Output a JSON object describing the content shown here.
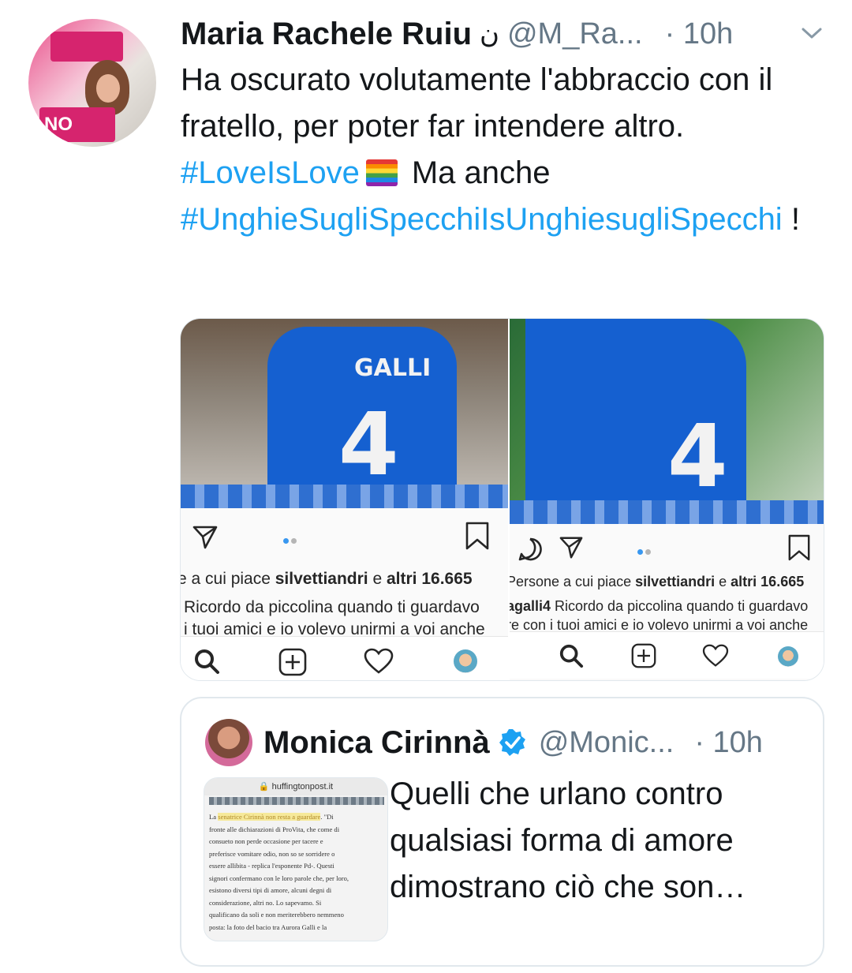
{
  "tweet": {
    "author": {
      "name": "Maria Rachele Ruiu",
      "name_extra": "ن",
      "handle": "@M_Ra...",
      "time": "· 10h",
      "avatar_badge_text": "NO"
    },
    "text": {
      "part1": "Ha oscurato volutamente l'abbraccio con il fratello, per poter far intendere altro. ",
      "hashtag1": "#LoveIsLove",
      "part2": "Ma anche",
      "hashtag2": "#UnghieSugliSpecchiIsUnghiesugliSpecchi",
      "part3": " !"
    },
    "media": {
      "left": {
        "jersey_name": "GALLI",
        "jersey_number": "4",
        "likes_prefix": "e a cui piace ",
        "likes_user": "silvettiandri",
        "likes_middle": " e ",
        "likes_others": "altri 16.665",
        "caption_line1": "Ricordo da piccolina quando ti guardavo",
        "caption_line2": "i tuoi amici e io volevo unirmi a voi anche"
      },
      "right": {
        "jersey_number": "4",
        "likes_prefix": "Persone a cui piace ",
        "likes_user": "silvettiandri",
        "likes_middle": " e ",
        "likes_others": "altri 16.665",
        "caption_user": "agalli4",
        "caption_line1": " Ricordo da piccolina quando ti guardavo",
        "caption_line2": "re con i tuoi amici e io volevo unirmi a voi anche"
      }
    }
  },
  "quoted": {
    "author": {
      "name": "Monica Cirinnà",
      "handle": "@Monic...",
      "time": "· 10h"
    },
    "thumbnail": {
      "url": "huffingtonpost.it",
      "line1_pre": "La ",
      "line1_hl": "senatrice Cirinnà non resta a guardare",
      "line1_post": ". \"Di",
      "line2": "fronte alle dichiarazioni di ProVita, che come di",
      "line3": "consueto non perde occasione per tacere e",
      "line4": "preferisce vomitare odio, non so se sorridere o",
      "line5": "essere allibita - replica l'esponente Pd-. Questi",
      "line6": "signori confermano con le loro parole che, per loro,",
      "line7": "esistono diversi tipi di amore, alcuni degni di",
      "line8": "considerazione, altri no. Lo sapevamo. Si",
      "line9": "qualificano da soli e non meriterebbero nemmeno",
      "line10": "posta: la foto del bacio tra Aurora Galli e la"
    },
    "text": "Quelli che urlano contro qualsiasi forma di amore dimostrano ciò che son…"
  },
  "colors": {
    "hashtag": "#1da1f2",
    "secondary_text": "#657786",
    "verified": "#1da1f2",
    "instagram_dot": "#3897f0"
  }
}
